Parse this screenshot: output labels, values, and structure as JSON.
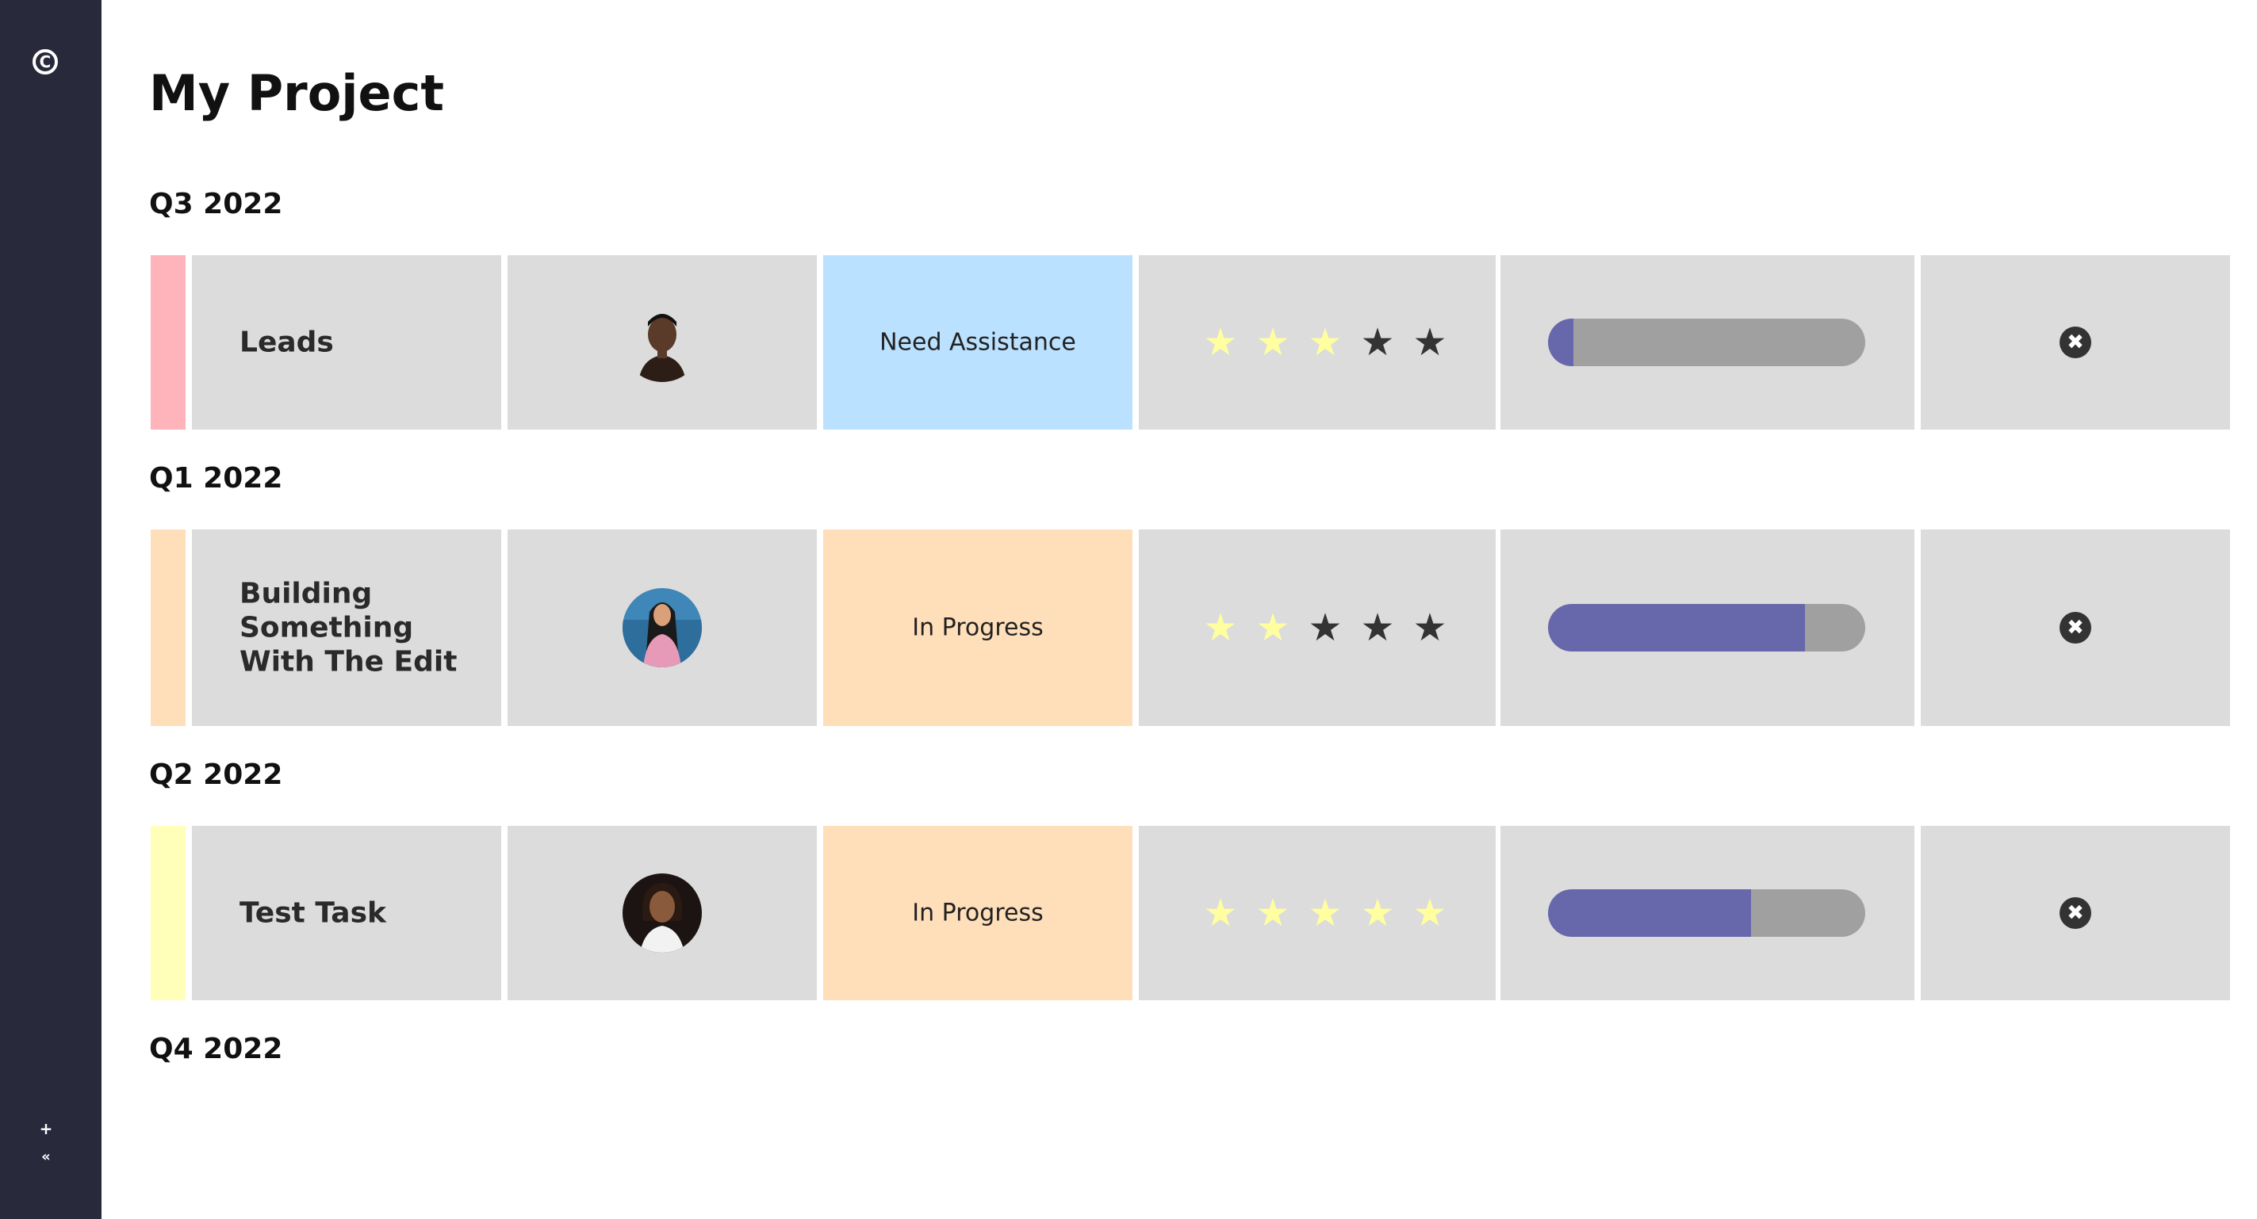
{
  "app": {
    "logo_glyph": "C",
    "add_label": "+",
    "collapse_label": "«",
    "colors": {
      "sidebar": "#282a3c",
      "cell_bg": "#dcdcdc",
      "progress_fill": "#6767ab",
      "progress_track": "#a0a0a0",
      "star_on": "#ffffa0",
      "star_off": "#333333"
    }
  },
  "page": {
    "title": "My Project"
  },
  "groups": [
    {
      "label": "Q3 2022",
      "task": "Leads",
      "group_color": "#ffb3ba",
      "avatar_icon": "person-avatar-icon",
      "status": "Need Assistance",
      "status_color": "#bae1ff",
      "rating": 3,
      "max_rating": 5,
      "progress": 0.08
    },
    {
      "label": "Q1 2022",
      "task": "Building Something With The Edit",
      "group_color": "#ffdfba",
      "avatar_icon": "person-avatar-icon",
      "status": "In Progress",
      "status_color": "#ffdfba",
      "rating": 2,
      "max_rating": 5,
      "progress": 0.81
    },
    {
      "label": "Q2 2022",
      "task": "Test Task",
      "group_color": "#ffffba",
      "avatar_icon": "person-avatar-icon",
      "status": "In Progress",
      "status_color": "#ffdfba",
      "rating": 5,
      "max_rating": 5,
      "progress": 0.64
    },
    {
      "label": "Q4 2022",
      "task": "",
      "group_color": "#baffc9",
      "avatar_icon": "person-avatar-icon",
      "status": "",
      "status_color": "#baffc9",
      "rating": 0,
      "max_rating": 5,
      "progress": 0
    }
  ]
}
